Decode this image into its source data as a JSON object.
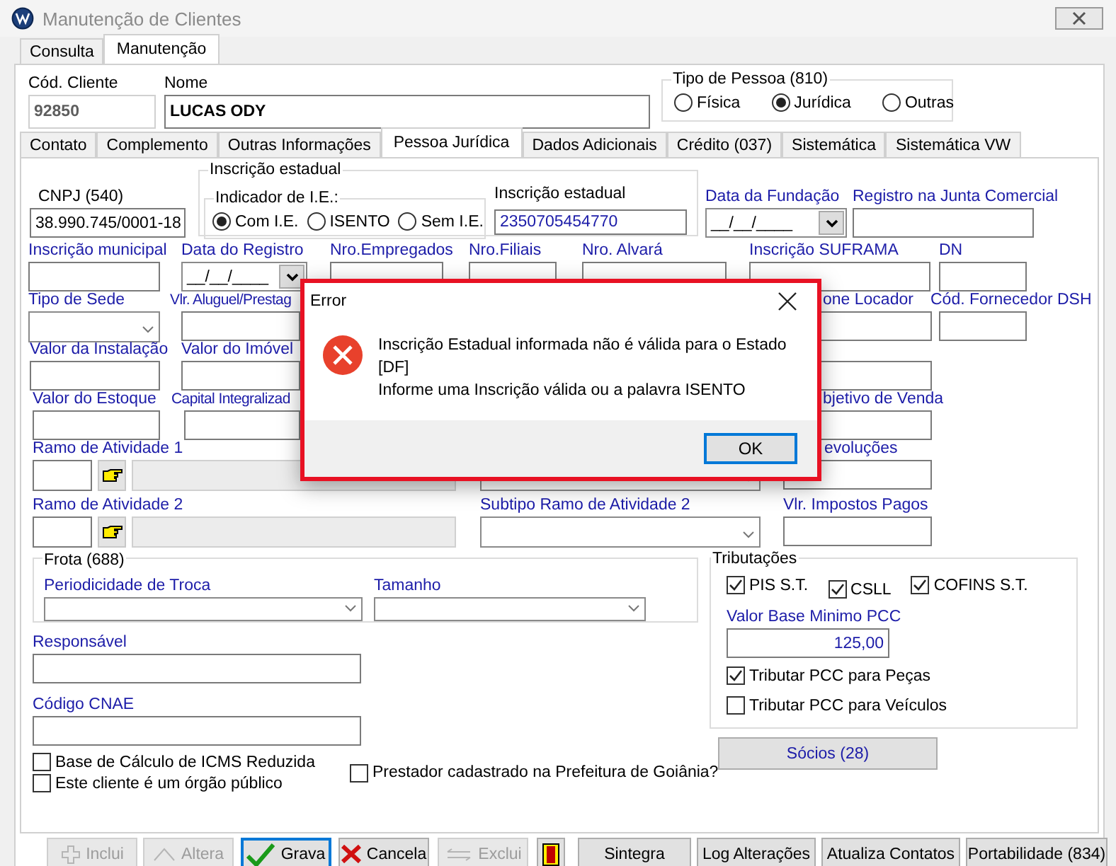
{
  "window": {
    "title": "Manutenção de Clientes"
  },
  "tabs": [
    {
      "label": "Consulta",
      "selected": false
    },
    {
      "label": "Manutenção",
      "selected": true
    }
  ],
  "header": {
    "cod_cliente": {
      "label": "Cód. Cliente",
      "value": "92850"
    },
    "nome": {
      "label": "Nome",
      "value": "LUCAS ODY"
    },
    "tipo_pessoa": {
      "title": "Tipo de Pessoa (810)",
      "options": [
        {
          "label": "Física",
          "selected": false
        },
        {
          "label": "Jurídica",
          "selected": true
        },
        {
          "label": "Outras",
          "selected": false
        }
      ]
    }
  },
  "inner_tabs": [
    {
      "label": "Contato",
      "selected": false
    },
    {
      "label": "Complemento",
      "selected": false
    },
    {
      "label": "Outras Informações",
      "selected": false
    },
    {
      "label": "Pessoa Jurídica",
      "selected": true
    },
    {
      "label": "Dados Adicionais",
      "selected": false
    },
    {
      "label": "Crédito (037)",
      "selected": false
    },
    {
      "label": "Sistemática",
      "selected": false
    },
    {
      "label": "Sistemática VW",
      "selected": false
    }
  ],
  "identificacao": {
    "cnpj": {
      "label": "CNPJ (540)",
      "value": "38.990.745/0001-18"
    },
    "inscricao_estadual": {
      "title": "Inscrição estadual",
      "indicador": {
        "title": "Indicador de I.E.:",
        "options": [
          {
            "label": "Com I.E.",
            "selected": true
          },
          {
            "label": "ISENTO",
            "selected": false
          },
          {
            "label": "Sem I.E.",
            "selected": false
          }
        ]
      },
      "field": {
        "label": "Inscrição estadual",
        "value": "2350705454770"
      }
    },
    "data_fundacao": {
      "label": "Data da Fundação",
      "value": "__/__/____"
    },
    "registro_junta": {
      "label": "Registro na Junta Comercial"
    }
  },
  "field_rows": [
    [
      {
        "kind": "text",
        "label": "Inscrição municipal"
      },
      {
        "kind": "date",
        "label": "Data do Registro",
        "value": "__/__/____"
      },
      {
        "kind": "text",
        "label": "Nro.Empregados"
      },
      {
        "kind": "text",
        "label": "Nro.Filiais"
      },
      {
        "kind": "text",
        "label": "Nro. Alvará"
      },
      {
        "kind": "text",
        "label": "Inscrição SUFRAMA"
      },
      {
        "kind": "text",
        "label": "DN"
      }
    ],
    [
      {
        "kind": "combo",
        "label": "Tipo de Sede"
      },
      {
        "kind": "text",
        "label": "Vlr. Aluguel/Prestag"
      },
      {
        "kind": "text",
        "label": "one Locador"
      },
      {
        "kind": "text",
        "label": "Cód. Fornecedor DSH"
      }
    ],
    [
      {
        "kind": "text",
        "label": "Valor da Instalação"
      },
      {
        "kind": "text",
        "label": "Valor do Imóvel"
      },
      {
        "kind": "text"
      }
    ],
    [
      {
        "kind": "text",
        "label": "Valor do Estoque"
      },
      {
        "kind": "text",
        "label": "Capital Integralizad"
      },
      {
        "kind": "text",
        "label": "bjetivo de Venda"
      }
    ],
    [
      {
        "kind": "lookup",
        "label": "Ramo de Atividade 1"
      },
      {
        "kind": "combo"
      },
      {
        "kind": "text",
        "label": "evoluções"
      }
    ],
    [
      {
        "kind": "lookup",
        "label": "Ramo de Atividade 2"
      },
      {
        "kind": "combo",
        "label": "Subtipo Ramo de Atividade 2"
      },
      {
        "kind": "text",
        "label": "Vlr. Impostos Pagos"
      }
    ]
  ],
  "frota": {
    "title": "Frota (688)",
    "fields": [
      {
        "kind": "combo",
        "label": "Periodicidade de Troca"
      },
      {
        "kind": "combo",
        "label": "Tamanho"
      }
    ]
  },
  "responsavel": {
    "label": "Responsável"
  },
  "codigo_cnae": {
    "label": "Código CNAE"
  },
  "options": [
    {
      "label": "Base de Cálculo de ICMS Reduzida",
      "checked": false
    },
    {
      "label": "Este cliente é um órgão público",
      "checked": false
    },
    {
      "label": "Prestador cadastrado na Prefeitura de Goiânia?",
      "checked": false
    }
  ],
  "tributacoes": {
    "title": "Tributações",
    "taxes": [
      {
        "label": "PIS S.T.",
        "checked": true
      },
      {
        "label": "CSLL",
        "checked": true
      },
      {
        "label": "COFINS S.T.",
        "checked": true
      }
    ],
    "valor_base": {
      "label": "Valor Base Minimo PCC",
      "value": "125,00"
    },
    "pcc": [
      {
        "label": "Tributar PCC para Peças",
        "checked": true
      },
      {
        "label": "Tributar PCC para Veículos",
        "checked": false
      }
    ]
  },
  "socios_button": {
    "label": "Sócios (28)"
  },
  "buttons": [
    {
      "kind": "text",
      "label": "Inclui",
      "disabled": true,
      "focused": false
    },
    {
      "kind": "text",
      "label": "Altera",
      "disabled": true,
      "focused": false
    },
    {
      "kind": "text",
      "label": "Grava",
      "disabled": false,
      "focused": true
    },
    {
      "kind": "text",
      "label": "Cancela",
      "disabled": false,
      "focused": false
    },
    {
      "kind": "text",
      "label": "Exclui",
      "disabled": true,
      "focused": false
    },
    {
      "kind": "icon",
      "disabled": false,
      "focused": false
    },
    {
      "kind": "text",
      "label": "Sintegra",
      "disabled": false,
      "focused": false
    },
    {
      "kind": "text",
      "label": "Log Alterações",
      "disabled": false,
      "focused": false
    },
    {
      "kind": "text",
      "label": "Atualiza Contatos",
      "disabled": false,
      "focused": false
    },
    {
      "kind": "text",
      "label": "Portabilidade (834)",
      "disabled": false,
      "focused": false
    }
  ],
  "dialog": {
    "title": "Error",
    "lines": [
      "Inscrição Estadual informada não é válida para o Estado",
      "[DF]",
      "Informe uma Inscrição válida ou a palavra ISENTO"
    ],
    "button": "OK"
  }
}
